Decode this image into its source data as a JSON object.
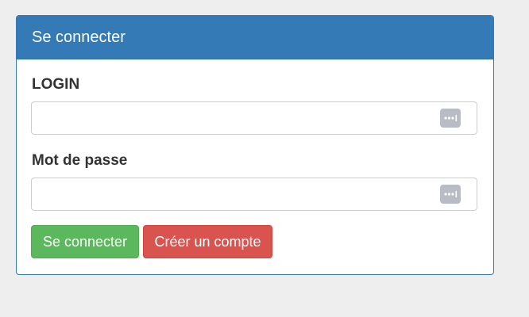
{
  "panel": {
    "title": "Se connecter"
  },
  "form": {
    "login_label": "LOGIN",
    "login_value": "",
    "password_label": "Mot de passe",
    "password_value": "",
    "password_manager_icon": "password-dots-icon"
  },
  "buttons": {
    "login_label": "Se connecter",
    "register_label": "Créer un compte"
  },
  "colors": {
    "primary": "#337ab7",
    "success": "#5cb85c",
    "danger": "#d9534f",
    "background": "#efeeef"
  }
}
